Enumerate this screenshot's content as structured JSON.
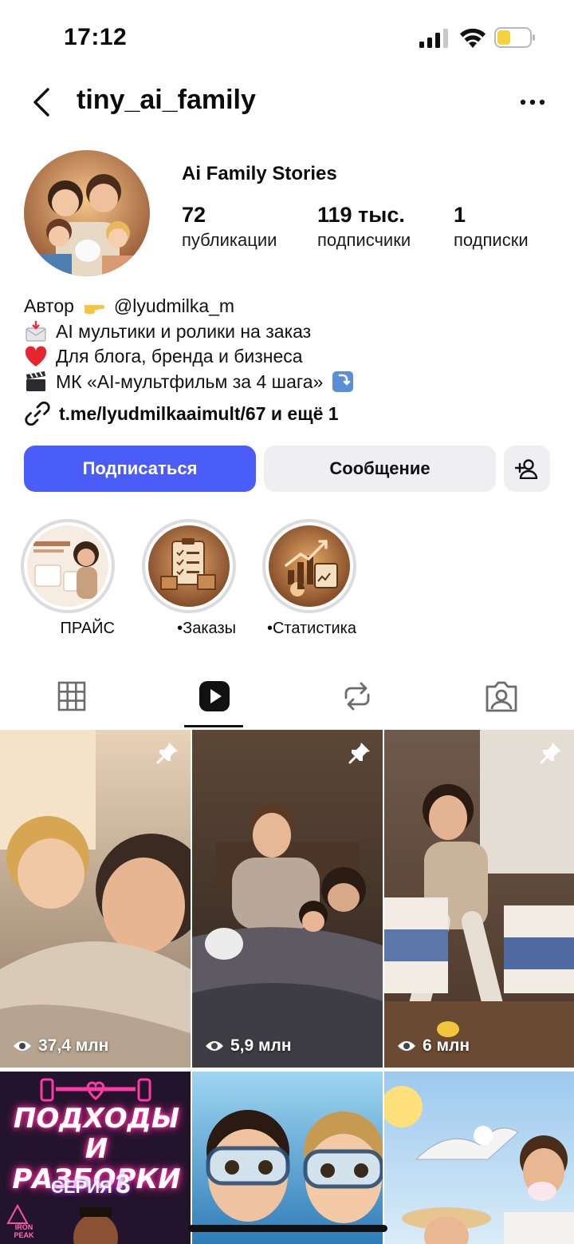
{
  "status_bar": {
    "time": "17:12"
  },
  "header": {
    "username": "tiny_ai_family"
  },
  "profile": {
    "display_name": "Ai Family Stories",
    "stats": [
      {
        "value": "72",
        "label": "публикации"
      },
      {
        "value": "119 тыс.",
        "label": "подписчики"
      },
      {
        "value": "1",
        "label": "подписки"
      }
    ],
    "bio": {
      "line1_prefix": "Автор",
      "line1_mention": "@lyudmilka_m",
      "line2": "AI мультики и ролики на заказ",
      "line3": "Для блога, бренда и бизнеса",
      "line4": "МК «AI-мультфильм за 4 шага»"
    },
    "link": "t.me/lyudmilkaaimult/67 и ещё 1"
  },
  "actions": {
    "follow_label": "Подписаться",
    "message_label": "Сообщение",
    "follow_color": "#4a5df9"
  },
  "highlights": [
    {
      "label": "ПРАЙС"
    },
    {
      "label": "•Заказы"
    },
    {
      "label": "•Статистика"
    }
  ],
  "tabs": [
    {
      "icon": "grid-icon"
    },
    {
      "icon": "reels-icon",
      "active": true
    },
    {
      "icon": "reposts-icon"
    },
    {
      "icon": "tagged-icon"
    }
  ],
  "posts": [
    {
      "views": "37,4 млн",
      "pinned": true
    },
    {
      "views": "5,9 млн",
      "pinned": true
    },
    {
      "views": "6 млн",
      "pinned": true
    },
    {
      "title": "ПОДХОДЫ И РАЗБОРКИ",
      "series_label": "СЕРИЯ",
      "series_number": "3",
      "brand": "IRON PEAK"
    },
    {},
    {}
  ]
}
